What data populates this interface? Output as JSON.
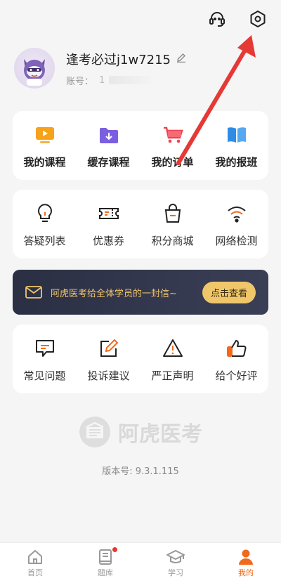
{
  "header": {
    "icons": [
      "headset-icon",
      "settings-icon"
    ]
  },
  "profile": {
    "username": "逢考必过j1w7215",
    "account_label": "账号：",
    "account_prefix": "1"
  },
  "main_menu": [
    {
      "label": "我的课程",
      "icon": "play-video-icon"
    },
    {
      "label": "缓存课程",
      "icon": "download-folder-icon"
    },
    {
      "label": "我的订单",
      "icon": "cart-icon"
    },
    {
      "label": "我的报班",
      "icon": "book-icon"
    }
  ],
  "tools_menu": [
    {
      "label": "答疑列表",
      "icon": "lightbulb-icon"
    },
    {
      "label": "优惠券",
      "icon": "coupon-icon"
    },
    {
      "label": "积分商城",
      "icon": "shopping-bag-icon"
    },
    {
      "label": "网络检测",
      "icon": "wifi-icon"
    }
  ],
  "banner": {
    "message": "阿虎医考给全体学员的一封信~",
    "button": "点击查看"
  },
  "help_menu": [
    {
      "label": "常见问题",
      "icon": "chat-bubble-icon"
    },
    {
      "label": "投诉建议",
      "icon": "edit-icon"
    },
    {
      "label": "严正声明",
      "icon": "warning-icon"
    },
    {
      "label": "给个好评",
      "icon": "thumbs-up-icon"
    }
  ],
  "watermark": "阿虎医考",
  "version": "版本号: 9.3.1.115",
  "tabs": [
    {
      "label": "首页",
      "icon": "home-icon"
    },
    {
      "label": "题库",
      "icon": "question-bank-icon"
    },
    {
      "label": "学习",
      "icon": "graduation-cap-icon"
    },
    {
      "label": "我的",
      "icon": "user-icon"
    }
  ],
  "colors": {
    "accent": "#f06a1c",
    "banner_bg": "#2b2f44",
    "banner_gold": "#f0c66b",
    "annotation": "#e53935"
  }
}
